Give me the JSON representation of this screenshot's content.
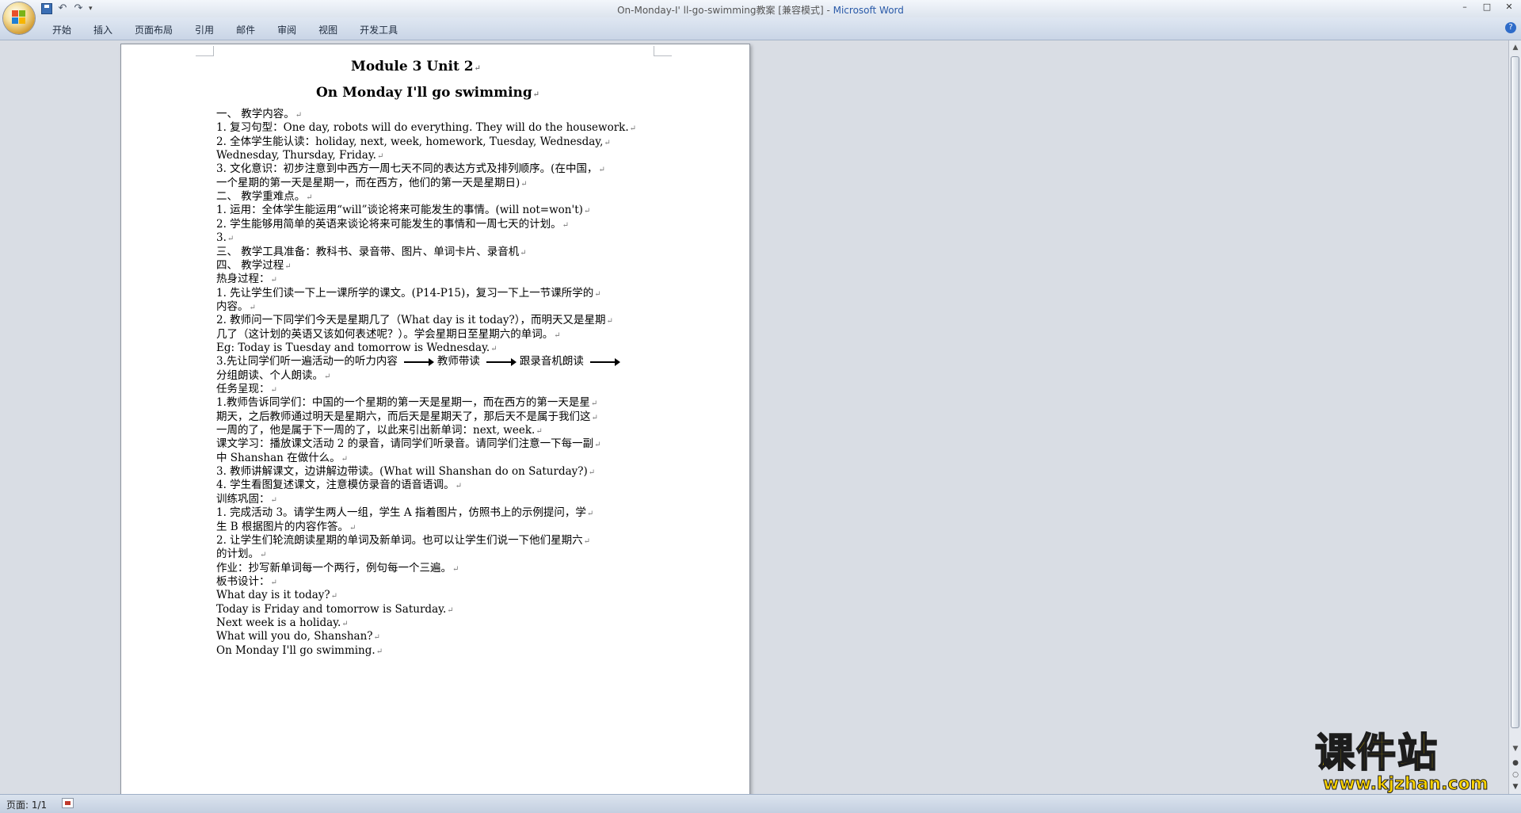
{
  "window": {
    "title_doc": "On-Monday-I' ll-go-swimming教案 [兼容模式] - ",
    "title_app": "Microsoft Word",
    "controls": [
      "–",
      "□",
      "✕"
    ]
  },
  "qat": {
    "dropdown": "▾",
    "undo": "↶",
    "redo": "↷"
  },
  "ribbon": {
    "tabs": [
      "开始",
      "插入",
      "页面布局",
      "引用",
      "邮件",
      "审阅",
      "视图",
      "开发工具"
    ],
    "help": "?"
  },
  "document": {
    "title1": "Module  3 Unit  2",
    "title2": "On Monday  I'll go swimming",
    "para_mark": "↵",
    "lines": [
      "一、    教学内容。",
      "1.   复习句型：One day, robots will do everything. They will do the housework.",
      "2.   全体学生能认读：holiday, next, week, homework, Tuesday, Wednesday,",
      "      Wednesday, Thursday, Friday.",
      "3.   文化意识：初步注意到中西方一周七天不同的表达方式及排列顺序。(在中国，",
      "      一个星期的第一天是星期一，而在西方，他们的第一天是星期日)",
      "二、    教学重难点。",
      "1.   运用：全体学生能运用“will”谈论将来可能发生的事情。(will not=won't)",
      "2.   学生能够用简单的英语来谈论将来可能发生的事情和一周七天的计划。",
      "3.",
      "三、    教学工具准备：教科书、录音带、图片、单词卡片、录音机",
      "四、    教学过程",
      "热身过程：",
      "1.   先让学生们读一下上一课所学的课文。(P14-P15)，复习一下上一节课所学的",
      "      内容。",
      "2.   教师问一下同学们今天是星期几了（What day is it today?），而明天又是星期",
      "      几了（这计划的英语又该如何表述呢？）。学会星期日至星期六的单词。",
      "Eg: Today is Tuesday and tomorrow is Wednesday.",
      "__ARROWLINE__",
      "分组朗读、个人朗读。",
      "任务呈现：",
      "1.教师告诉同学们：中国的一个星期的第一天是星期一，而在西方的第一天是星",
      "期天，之后教师通过明天是星期六，而后天是星期天了，那后天不是属于我们这",
      "一周的了，他是属于下一周的了，以此来引出新单词：next, week.",
      "课文学习：播放课文活动 2 的录音，请同学们听录音。请同学们注意一下每一副",
      "中 Shanshan 在做什么。",
      "3.   教师讲解课文，边讲解边带读。(What will Shanshan do on Saturday?)",
      "4.   学生看图复述课文，注意模仿录音的语音语调。",
      "训练巩固：",
      "1.   完成活动 3。请学生两人一组，学生 A 指着图片，仿照书上的示例提问，学",
      "      生 B 根据图片的内容作答。",
      "2.   让学生们轮流朗读星期的单词及新单词。也可以让学生们说一下他们星期六",
      "      的计划。",
      "作业：抄写新单词每一个两行，例句每一个三遍。",
      "板书设计：",
      "What day is it today?",
      "Today is Friday and tomorrow is Saturday.",
      "Next week is  a holiday.",
      "What will you do, Shanshan?",
      "On Monday I'll go swimming."
    ],
    "arrow_line": {
      "p1": "3.先让同学们听一遍活动一的听力内容",
      "p2": "教师带读",
      "p3": "跟录音机朗读"
    }
  },
  "statusbar": {
    "page": "页面: 1/1"
  },
  "scrollbar": {
    "up": "▲",
    "down": "▼",
    "prev": "●",
    "browse": "○",
    "next": "▼"
  },
  "watermark": {
    "main": "课件站",
    "url": "www.kjzhan.com"
  }
}
